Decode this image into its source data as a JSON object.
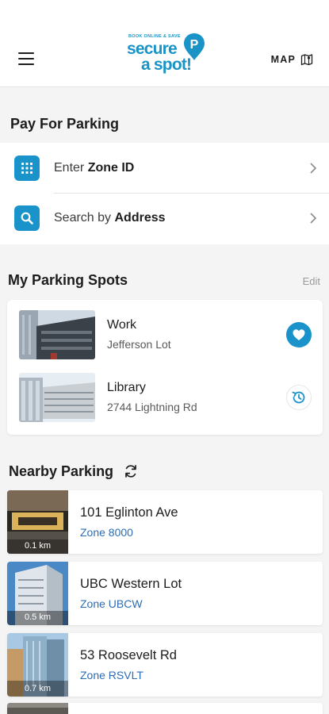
{
  "header": {
    "logo_tagline": "BOOK ONLINE & SAVE",
    "logo_line1": "secure",
    "logo_line2": "a spot!",
    "logo_letter": "P",
    "map_label": "MAP"
  },
  "pay_for_parking": {
    "title": "Pay For Parking",
    "rows": [
      {
        "label_prefix": "Enter ",
        "label_bold": "Zone ID",
        "icon": "keypad-icon"
      },
      {
        "label_prefix": "Search by ",
        "label_bold": "Address",
        "icon": "search-icon"
      }
    ]
  },
  "my_spots": {
    "title": "My Parking Spots",
    "edit_label": "Edit",
    "items": [
      {
        "name": "Work",
        "location": "Jefferson Lot",
        "action_icon": "heart-icon"
      },
      {
        "name": "Library",
        "location": "2744 Lightning Rd",
        "action_icon": "history-icon"
      }
    ]
  },
  "nearby": {
    "title": "Nearby Parking",
    "items": [
      {
        "name": "101 Eglinton Ave",
        "zone": "Zone 8000",
        "distance": "0.1 km"
      },
      {
        "name": "UBC Western Lot",
        "zone": "Zone UBCW",
        "distance": "0.5 km"
      },
      {
        "name": "53 Roosevelt Rd",
        "zone": "Zone RSVLT",
        "distance": "0.7 km"
      }
    ]
  },
  "colors": {
    "accent": "#1993c9",
    "zone_link": "#2c6db4",
    "background": "#f4f4f4"
  }
}
